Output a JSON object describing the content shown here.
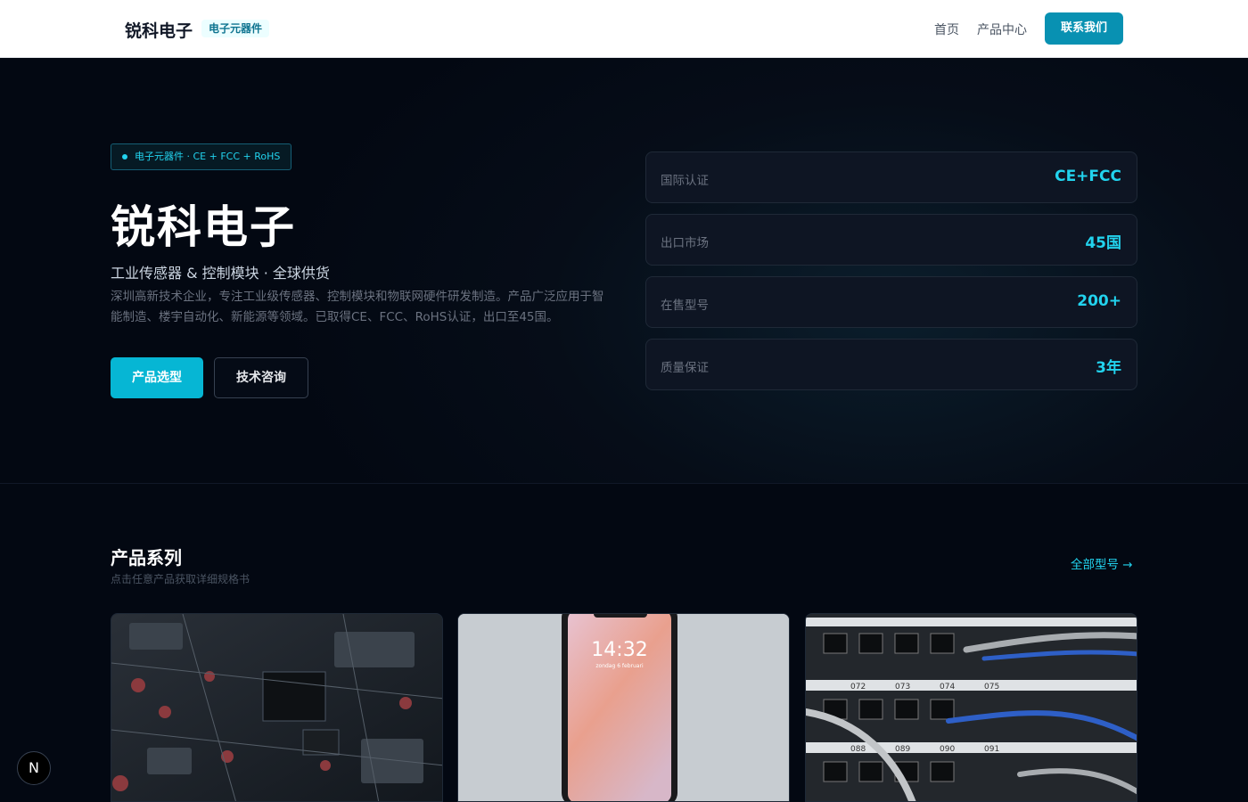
{
  "header": {
    "brand": "锐科电子",
    "badge": "电子元器件",
    "nav": [
      "首页",
      "产品中心"
    ],
    "contact": "联系我们"
  },
  "hero": {
    "tag": "电子元器件 · CE + FCC + RoHS",
    "title": "锐科电子",
    "subtitle": "工业传感器 & 控制模块 · 全球供货",
    "description": "深圳高新技术企业，专注工业级传感器、控制模块和物联网硬件研发制造。产品广泛应用于智能制造、楼宇自动化、新能源等领域。已取得CE、FCC、RoHS认证，出口至45国。",
    "primary_button": "产品选型",
    "secondary_button": "技术咨询",
    "stats": [
      {
        "label": "国际认证",
        "value": "CE+FCC"
      },
      {
        "label": "出口市场",
        "value": "45国"
      },
      {
        "label": "在售型号",
        "value": "200+"
      },
      {
        "label": "质量保证",
        "value": "3年"
      }
    ]
  },
  "products": {
    "title": "产品系列",
    "subtitle": "点击任意产品获取详细规格书",
    "all_link": "全部型号 →",
    "phone_time": "14:32",
    "phone_date": "zondag 6 februari",
    "patch_labels": [
      "072",
      "073",
      "074",
      "075",
      "088",
      "089",
      "090",
      "091"
    ]
  },
  "badge": "N",
  "colors": {
    "accent": "#06b6d4",
    "accent_text": "#22d3ee",
    "header_button": "#0891b2",
    "hero_bg": "#030812"
  }
}
